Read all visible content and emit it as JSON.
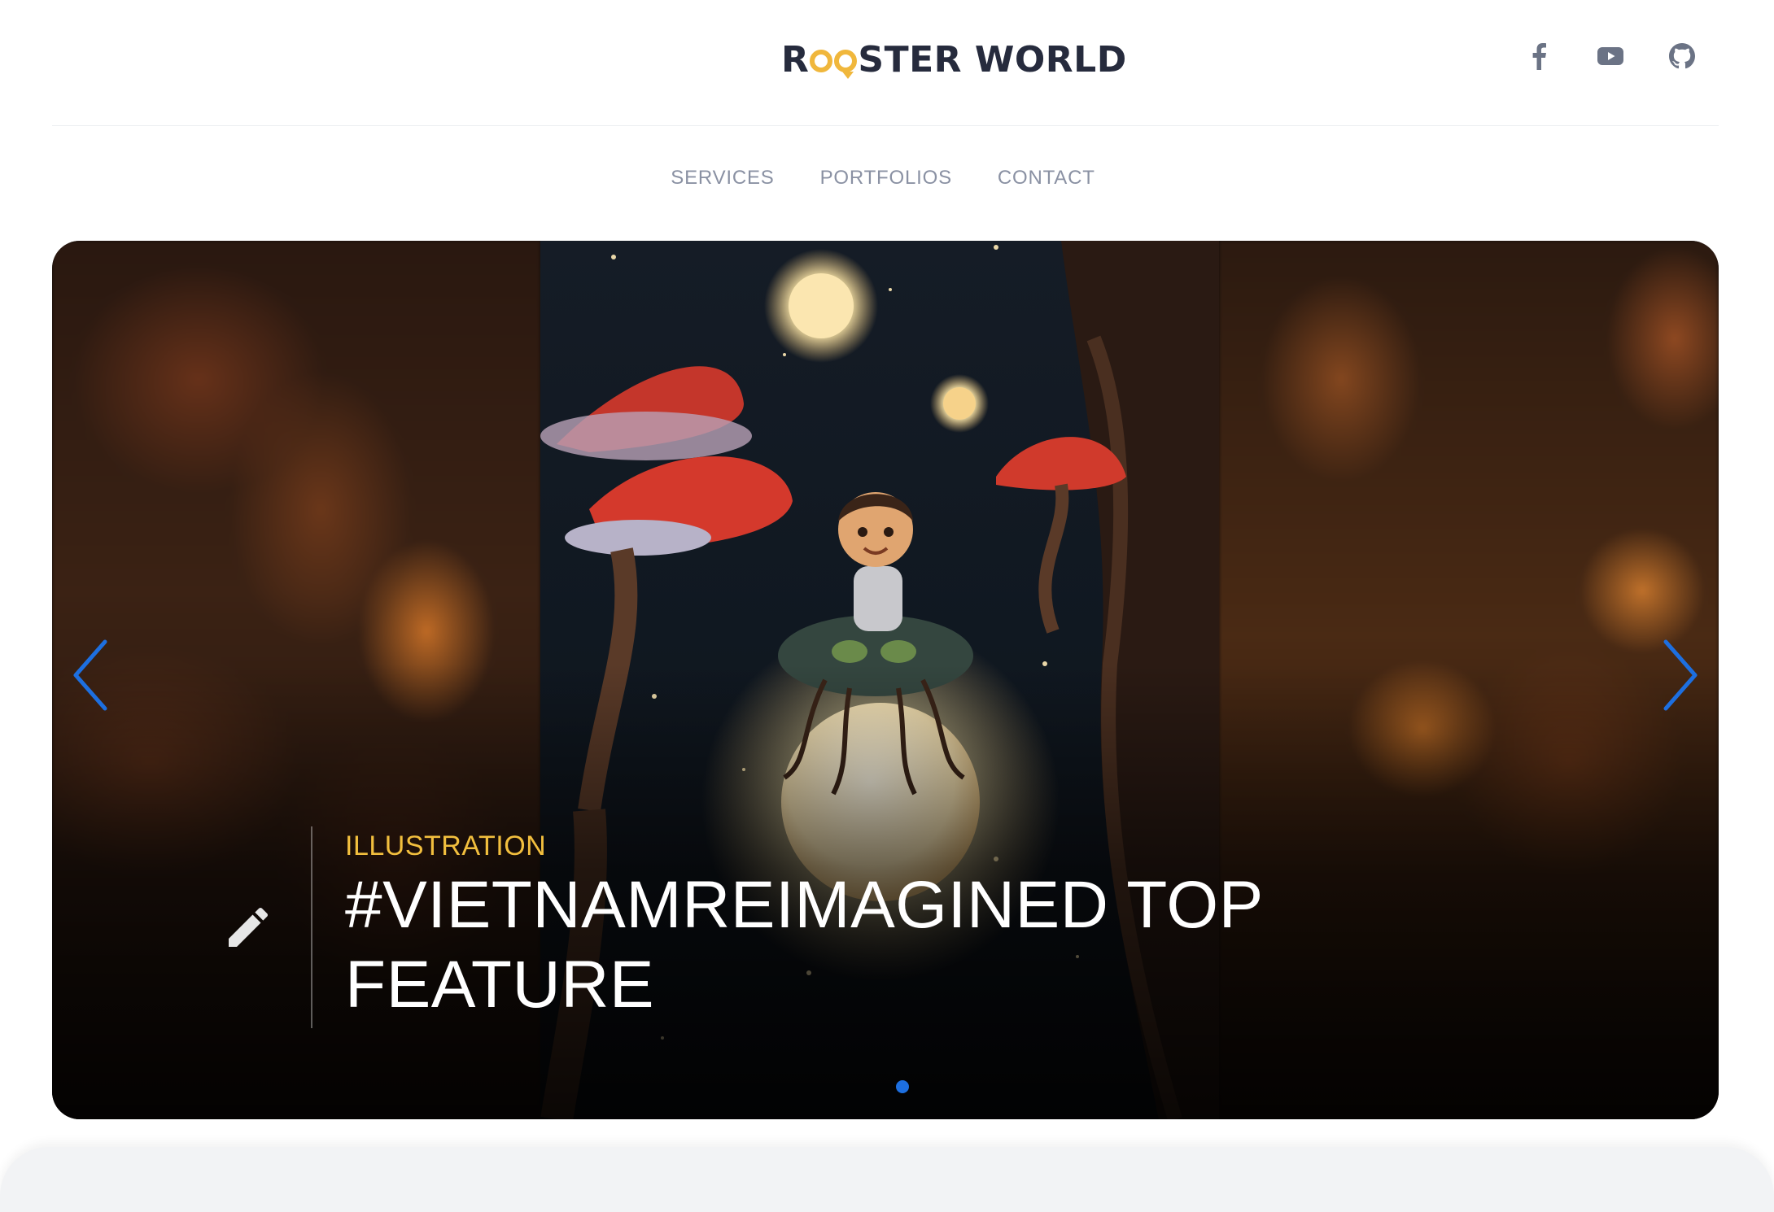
{
  "header": {
    "logo": {
      "part1": "R",
      "part2": "STER WORLD"
    },
    "socials": [
      {
        "icon": "facebook-icon"
      },
      {
        "icon": "youtube-icon"
      },
      {
        "icon": "github-icon"
      }
    ]
  },
  "nav": {
    "items": [
      {
        "label": "SERVICES"
      },
      {
        "label": "PORTFOLIOS"
      },
      {
        "label": "CONTACT"
      }
    ]
  },
  "hero": {
    "category": "ILLUSTRATION",
    "title": "#VIETNAMREIMAGINED TOP FEATURE",
    "caption_icon": "pencil-icon",
    "prev_icon": "chevron-left-icon",
    "next_icon": "chevron-right-icon",
    "slide_count": 1,
    "active_slide": 1
  },
  "colors": {
    "accent": "#1d6fe0",
    "category": "#f2bf3e",
    "logo_dark": "#262b3d",
    "logo_gold": "#f0b73c",
    "nav_text": "#8a91a3"
  }
}
